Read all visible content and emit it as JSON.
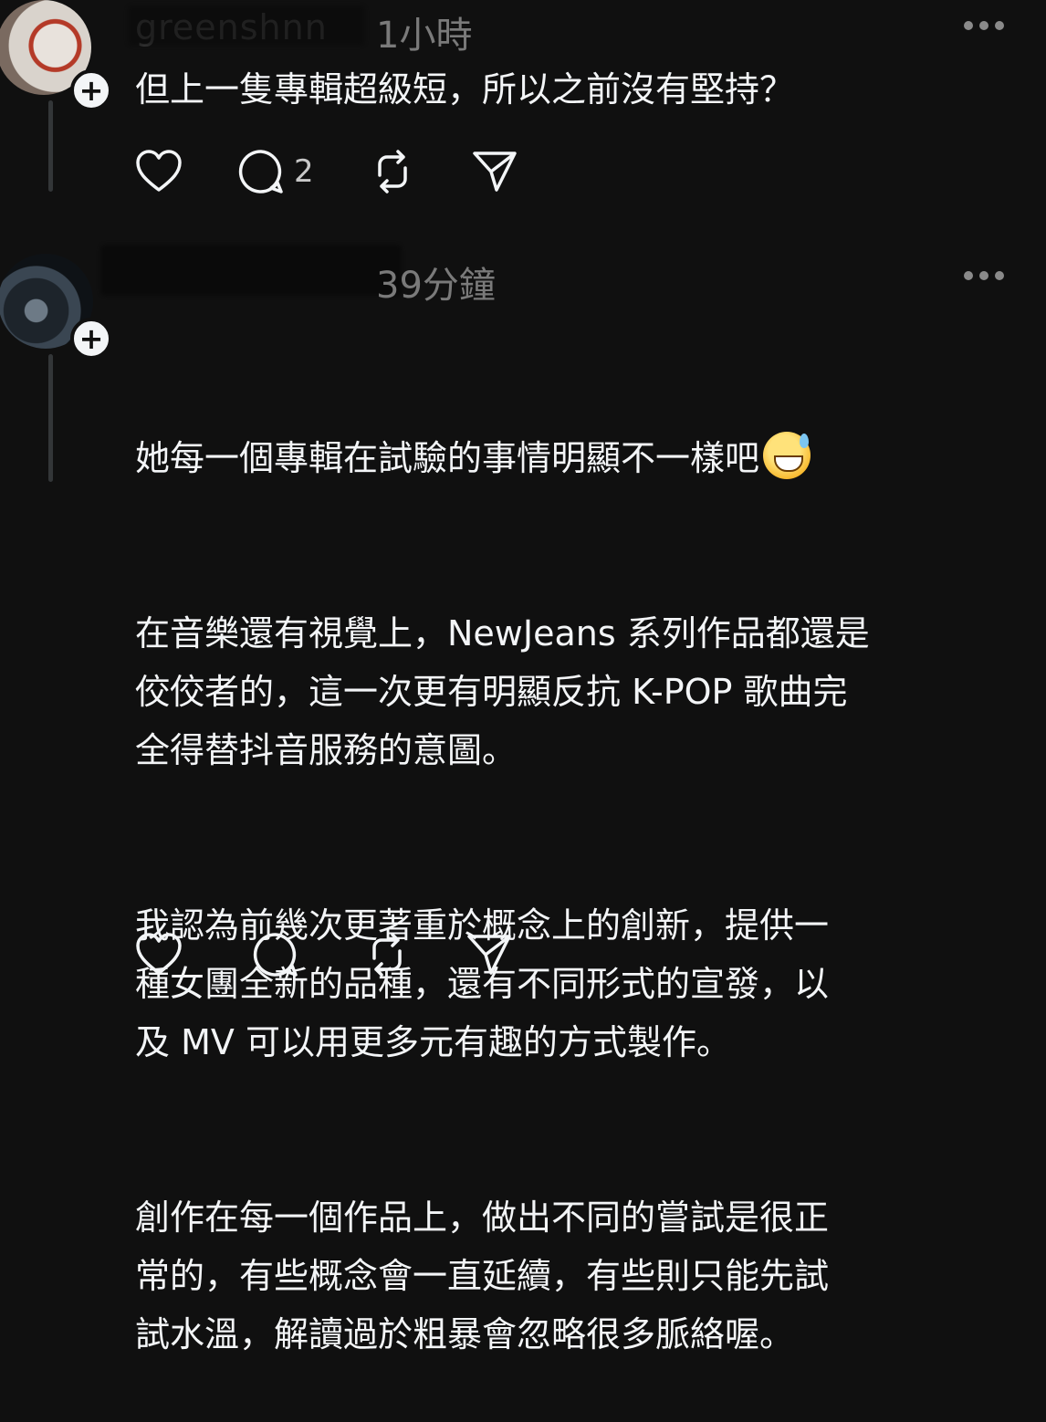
{
  "posts": [
    {
      "username": "greenshnn",
      "time": "1小時",
      "text": "但上一隻專輯超級短，所以之前沒有堅持？",
      "reply_count": "2"
    },
    {
      "username": "",
      "time": "39分鐘",
      "emoji": "grinning-face-with-sweat",
      "paragraphs": [
        "她每一個專輯在試驗的事情明顯不一樣吧",
        "在音樂還有視覺上，NewJeans 系列作品都還是\n佼佼者的，這一次更有明顯反抗 K-POP 歌曲完\n全得替抖音服務的意圖。",
        "我認為前幾次更著重於概念上的創新，提供一\n種女團全新的品種，還有不同形式的宣發，以\n及 MV 可以用更多元有趣的方式製作。",
        "創作在每一個作品上，做出不同的嘗試是很正\n常的，有些概念會一直延續，有些則只能先試\n試水溫，解讀過於粗暴會忽略很多脈絡喔。"
      ]
    }
  ],
  "icons": {
    "like": "heart-icon",
    "reply": "comment-icon",
    "repost": "repost-icon",
    "share": "send-icon",
    "more": "more-dots-icon",
    "follow": "plus-icon"
  },
  "colors": {
    "background": "#101010",
    "text": "#f3f5f7",
    "muted": "#7a7a7a"
  }
}
